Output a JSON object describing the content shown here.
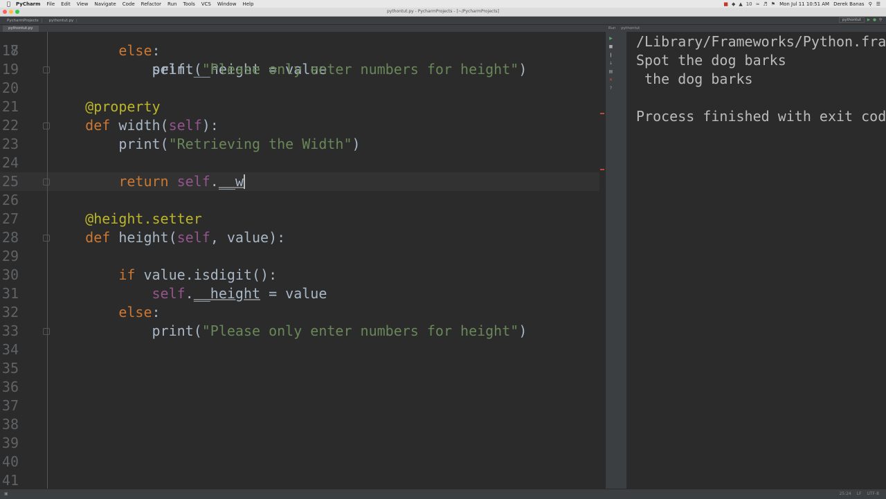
{
  "menubar": {
    "app_name": "PyCharm",
    "items": [
      "File",
      "Edit",
      "View",
      "Navigate",
      "Code",
      "Refactor",
      "Run",
      "Tools",
      "VCS",
      "Window",
      "Help"
    ],
    "clock": "Mon Jul 11  10:51 AM",
    "user": "Derek Banas",
    "battery": "10"
  },
  "window": {
    "title": "pythontut.py - PycharmProjects - [~/PycharmProjects]"
  },
  "navbar": {
    "project": "PycharmProjects",
    "file": "pythontut.py",
    "run_config": "pythontut"
  },
  "tabs": [
    {
      "label": "pythontut.py"
    }
  ],
  "run_panel": {
    "header_label": "Run",
    "config": "pythontut",
    "output": [
      "/Library/Frameworks/Python.fra",
      "Spot the dog barks",
      " the dog barks",
      "",
      "Process finished with exit cod"
    ]
  },
  "editor": {
    "partial_top_line": "            self.__height = value",
    "lines": [
      {
        "n": "18",
        "indent": "        ",
        "tokens": [
          {
            "t": "else",
            "c": "kw"
          },
          {
            "t": ":",
            "c": ""
          }
        ]
      },
      {
        "n": "19",
        "indent": "            ",
        "tokens": [
          {
            "t": "print(",
            "c": ""
          },
          {
            "t": "\"Please only enter numbers for height\"",
            "c": "str"
          },
          {
            "t": ")",
            "c": ""
          }
        ]
      },
      {
        "n": "20",
        "indent": "",
        "tokens": []
      },
      {
        "n": "21",
        "indent": "    ",
        "tokens": [
          {
            "t": "@property",
            "c": "deco"
          }
        ]
      },
      {
        "n": "22",
        "indent": "    ",
        "tokens": [
          {
            "t": "def ",
            "c": "kw"
          },
          {
            "t": "width(",
            "c": ""
          },
          {
            "t": "self",
            "c": "selfkw"
          },
          {
            "t": "):",
            "c": ""
          }
        ]
      },
      {
        "n": "23",
        "indent": "        ",
        "tokens": [
          {
            "t": "print(",
            "c": ""
          },
          {
            "t": "\"Retrieving the Width\"",
            "c": "str"
          },
          {
            "t": ")",
            "c": ""
          }
        ]
      },
      {
        "n": "24",
        "indent": "",
        "tokens": []
      },
      {
        "n": "25",
        "indent": "        ",
        "tokens": [
          {
            "t": "return ",
            "c": "kw"
          },
          {
            "t": "self",
            "c": "selfkw"
          },
          {
            "t": ".",
            "c": ""
          },
          {
            "t": "__w",
            "c": "underscore"
          }
        ],
        "current": true
      },
      {
        "n": "26",
        "indent": "",
        "tokens": []
      },
      {
        "n": "27",
        "indent": "    ",
        "tokens": [
          {
            "t": "@height.setter",
            "c": "deco"
          }
        ]
      },
      {
        "n": "28",
        "indent": "    ",
        "tokens": [
          {
            "t": "def ",
            "c": "kw"
          },
          {
            "t": "height(",
            "c": ""
          },
          {
            "t": "self",
            "c": "selfkw"
          },
          {
            "t": ", value):",
            "c": ""
          }
        ]
      },
      {
        "n": "29",
        "indent": "",
        "tokens": []
      },
      {
        "n": "30",
        "indent": "        ",
        "tokens": [
          {
            "t": "if ",
            "c": "kw"
          },
          {
            "t": "value.isdigit():",
            "c": ""
          }
        ]
      },
      {
        "n": "31",
        "indent": "            ",
        "tokens": [
          {
            "t": "self",
            "c": "selfkw"
          },
          {
            "t": ".",
            "c": ""
          },
          {
            "t": "__height",
            "c": "underscore"
          },
          {
            "t": " = value",
            "c": ""
          }
        ]
      },
      {
        "n": "32",
        "indent": "        ",
        "tokens": [
          {
            "t": "else",
            "c": "kw"
          },
          {
            "t": ":",
            "c": ""
          }
        ]
      },
      {
        "n": "33",
        "indent": "            ",
        "tokens": [
          {
            "t": "print(",
            "c": ""
          },
          {
            "t": "\"Please only enter numbers for height\"",
            "c": "str"
          },
          {
            "t": ")",
            "c": ""
          }
        ]
      },
      {
        "n": "34",
        "indent": "",
        "tokens": []
      },
      {
        "n": "35",
        "indent": "",
        "tokens": []
      },
      {
        "n": "36",
        "indent": "",
        "tokens": []
      },
      {
        "n": "37",
        "indent": "",
        "tokens": []
      },
      {
        "n": "38",
        "indent": "",
        "tokens": []
      },
      {
        "n": "39",
        "indent": "",
        "tokens": []
      },
      {
        "n": "40",
        "indent": "",
        "tokens": []
      },
      {
        "n": "41",
        "indent": "",
        "tokens": []
      }
    ]
  },
  "statusbar": {
    "position": "25:24",
    "line_sep": "LF",
    "encoding": "UTF-8"
  },
  "colors": {
    "keyword": "#cc7832",
    "string": "#6a8759",
    "decorator": "#bbb529",
    "self": "#94558d",
    "background": "#2b2b2b"
  }
}
